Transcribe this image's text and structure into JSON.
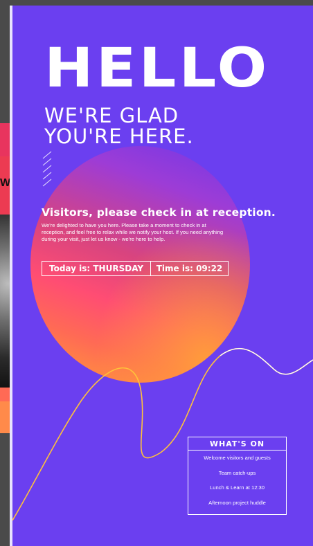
{
  "background_screen": {
    "partial_word": "W",
    "colors": {
      "top": "#e8345e",
      "red": "#ec3b52",
      "coral": "#ff6a55",
      "orange": "#ff8a4a"
    }
  },
  "sign": {
    "background": "#6b3ff0",
    "hello": "HELLO",
    "glad_line1": "WE'RE GLAD",
    "glad_line2": "YOU'RE HERE.",
    "checkin_heading": "Visitors, please check in at reception.",
    "checkin_body": "We're delighted to have you here. Please take a moment to check in at reception, and feel free to relax while we notify your host. If you need anything during your visit, just let us know - we're here to help.",
    "today": "Today is: THURSDAY",
    "time": "Time is: 09:22",
    "orb_colors": [
      "#6f38e8",
      "#d8447f",
      "#ff4d73",
      "#ffa035"
    ],
    "squiggle_color": "#ffc23a"
  },
  "whats_on": {
    "title": "WHAT'S ON",
    "items": [
      "Welcome visitors and guests",
      "Team catch-ups",
      "Lunch & Learn at 12:30",
      "Afternoon project huddle"
    ]
  }
}
